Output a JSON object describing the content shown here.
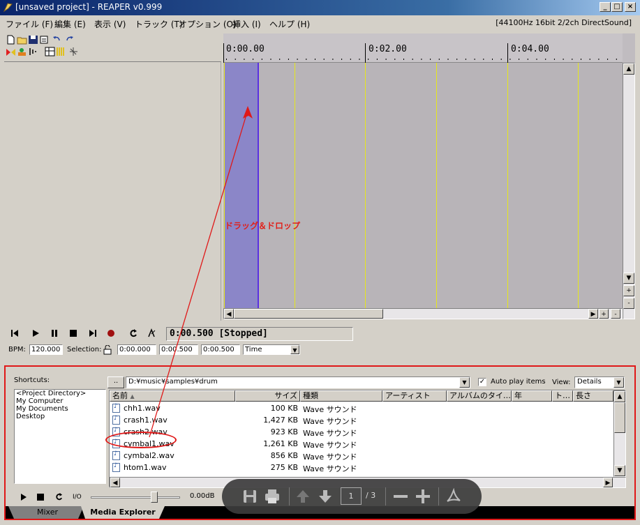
{
  "window": {
    "title": "[unsaved project] - REAPER v0.999",
    "minimize": "_",
    "maximize": "□",
    "close": "×"
  },
  "menu": [
    "ファイル (F)",
    "編集 (E)",
    "表示 (V)",
    "トラック (T)",
    "オプション (O)",
    "挿入 (I)",
    "ヘルプ (H)"
  ],
  "audio_info": "[44100Hz 16bit 2/2ch DirectSound]",
  "ruler": {
    "labels": [
      "0:00.00",
      "0:02.00",
      "0:04.00"
    ]
  },
  "drag_label": "ドラッグ＆ドロップ",
  "transport": {
    "time": "0:00.500 [Stopped]",
    "bpm_label": "BPM:",
    "bpm_value": "120.000",
    "selection_label": "Selection:",
    "sel_start": "0:00.000",
    "sel_end": "0:00.500",
    "sel_length": "0:00.500",
    "time_mode": "Time"
  },
  "explorer": {
    "shortcuts_label": "Shortcuts:",
    "shortcuts": [
      "<Project Directory>",
      "My Computer",
      "My Documents",
      "Desktop"
    ],
    "path_button": "..",
    "path": "D:¥music¥samples¥drum",
    "autoplay_label": "Auto play items",
    "autoplay_checked": "✓",
    "view_label": "View:",
    "view_value": "Details",
    "columns": [
      "名前",
      "サイズ",
      "種類",
      "アーティスト",
      "アルバムのタイ…",
      "年",
      "ト…",
      "長さ"
    ],
    "files": [
      {
        "name": "chh1.wav",
        "size": "100 KB",
        "type": "Wave サウンド"
      },
      {
        "name": "crash1.wav",
        "size": "1,427 KB",
        "type": "Wave サウンド"
      },
      {
        "name": "crash2.wav",
        "size": "923 KB",
        "type": "Wave サウンド"
      },
      {
        "name": "cymbal1.wav",
        "size": "1,261 KB",
        "type": "Wave サウンド"
      },
      {
        "name": "cymbal2.wav",
        "size": "856 KB",
        "type": "Wave サウンド"
      },
      {
        "name": "htom1.wav",
        "size": "275 KB",
        "type": "Wave サウンド"
      }
    ],
    "volume_label": "0.00dB",
    "io_label": "I/O"
  },
  "tabs": [
    "Mixer",
    "Media Explorer"
  ],
  "pdf_toolbar": {
    "page": "1",
    "total": "/ 3"
  },
  "colors": {
    "accent_red": "#e01818",
    "selection": "#8b86c8",
    "grid": "#e6e61a"
  }
}
